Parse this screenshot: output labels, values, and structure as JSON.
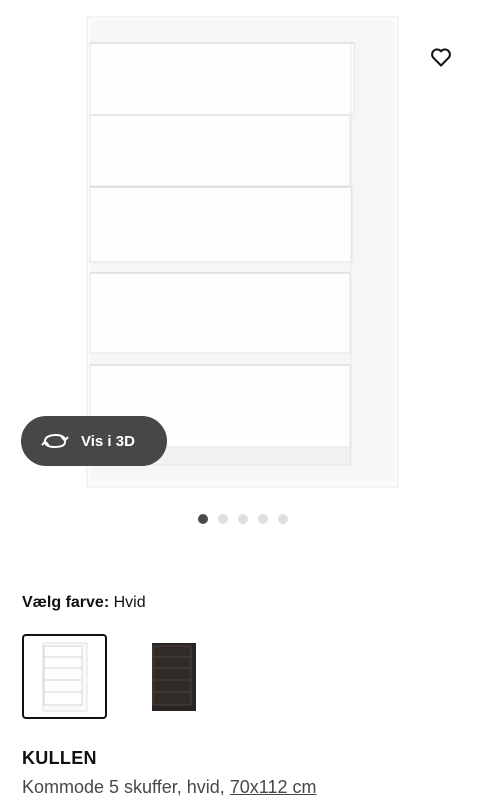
{
  "product": {
    "name": "KULLEN",
    "description_prefix": "Kommode 5 skuffer, hvid, ",
    "dimensions_link": "70x112 cm"
  },
  "hero": {
    "view_3d_label": "Vis i 3D",
    "image_count": 5,
    "active_image": 1
  },
  "color": {
    "label": "Vælg farve:",
    "selected": "Hvid",
    "options": [
      {
        "name": "hvid",
        "color": "#ffffff",
        "selected": true
      },
      {
        "name": "sortbrun",
        "color": "#2a2522",
        "selected": false
      }
    ]
  },
  "icons": {
    "favorite": "heart-icon",
    "view_3d": "rotate-3d-icon"
  }
}
